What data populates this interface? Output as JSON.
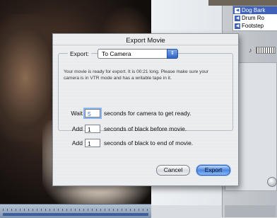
{
  "dialog": {
    "title": "Export Movie",
    "export_label": "Export:",
    "export_selected": "To Camera",
    "message": "Your movie is ready for export.  It is 00:21 long. Please make sure your camera is in VTR mode and has a writable tape in it.",
    "wait_label": "Wait",
    "wait_value": "5",
    "wait_suffix": "seconds for camera to get ready.",
    "black_before_label": "Add",
    "black_before_value": "1",
    "black_before_suffix": "seconds of black before movie.",
    "black_end_label": "Add",
    "black_end_value": "1",
    "black_end_suffix": "seconds of black to end of movie.",
    "cancel_label": "Cancel",
    "export_button_label": "Export"
  },
  "audio_tracks": [
    {
      "label": "Dog Bark",
      "selected": true
    },
    {
      "label": "Drum Ro",
      "selected": false
    },
    {
      "label": "Footstep",
      "selected": false
    }
  ],
  "colors": {
    "accent": "#3f62b8",
    "default_button": "#4c86e0"
  }
}
